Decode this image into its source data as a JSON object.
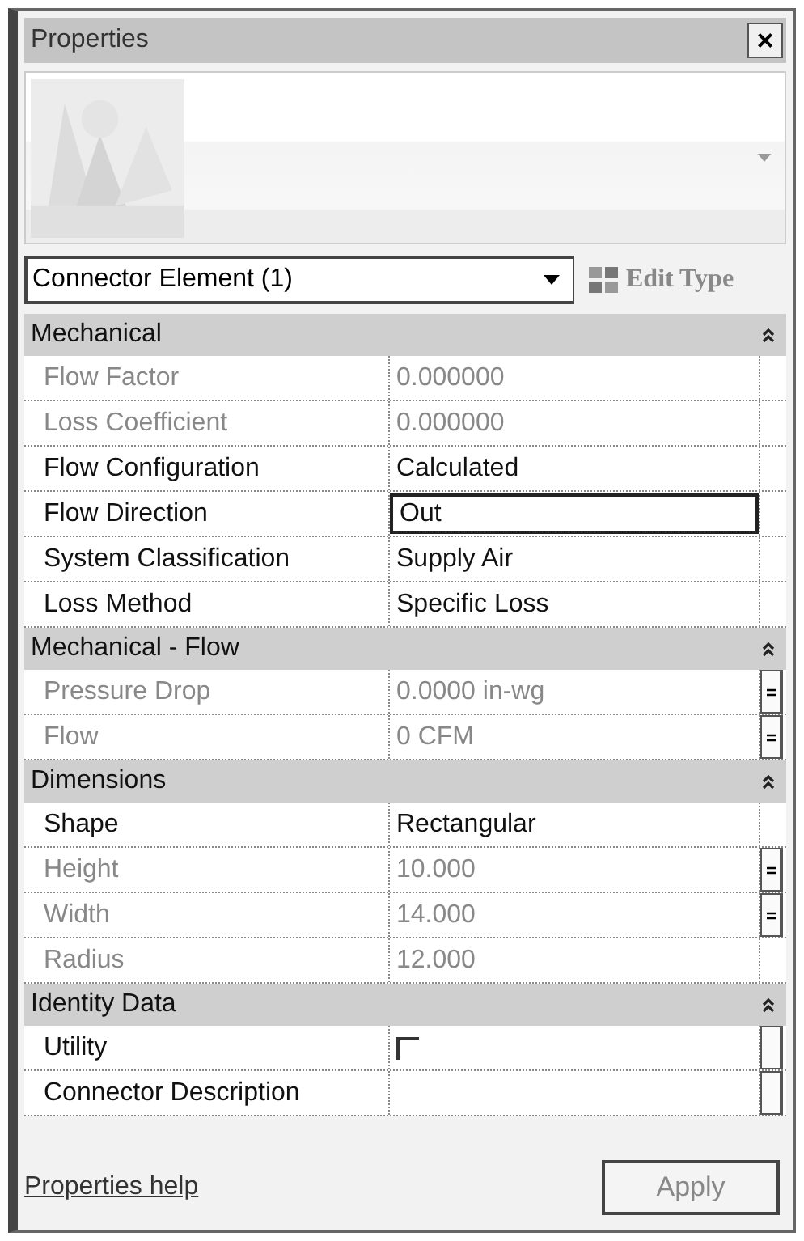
{
  "window": {
    "title": "Properties",
    "close": "×"
  },
  "type_selector": {
    "value": "Connector Element (1)",
    "edit_type": "Edit Type"
  },
  "groups": [
    {
      "title": "Mechanical",
      "expanded": true,
      "rows": [
        {
          "kind": "text",
          "label": "Flow Factor",
          "value": "0.000000",
          "disabled": true,
          "focused": false,
          "has_button": false
        },
        {
          "kind": "text",
          "label": "Loss Coefficient",
          "value": "0.000000",
          "disabled": true,
          "focused": false,
          "has_button": false
        },
        {
          "kind": "text",
          "label": "Flow Configuration",
          "value": "Calculated",
          "disabled": false,
          "focused": false,
          "has_button": false
        },
        {
          "kind": "text",
          "label": "Flow Direction",
          "value": "Out",
          "disabled": false,
          "focused": true,
          "has_button": false
        },
        {
          "kind": "text",
          "label": "System Classification",
          "value": "Supply Air",
          "disabled": false,
          "focused": false,
          "has_button": false
        },
        {
          "kind": "text",
          "label": "Loss Method",
          "value": "Specific Loss",
          "disabled": false,
          "focused": false,
          "has_button": false
        }
      ]
    },
    {
      "title": "Mechanical - Flow",
      "expanded": true,
      "rows": [
        {
          "kind": "text",
          "label": "Pressure Drop",
          "value": "0.0000 in-wg",
          "disabled": true,
          "focused": false,
          "has_button": true,
          "linked": true
        },
        {
          "kind": "text",
          "label": "Flow",
          "value": "0 CFM",
          "disabled": true,
          "focused": false,
          "has_button": true,
          "linked": true
        }
      ]
    },
    {
      "title": "Dimensions",
      "expanded": true,
      "rows": [
        {
          "kind": "text",
          "label": "Shape",
          "value": "Rectangular",
          "disabled": false,
          "focused": false,
          "has_button": false
        },
        {
          "kind": "text",
          "label": "Height",
          "value": "10.000",
          "disabled": true,
          "focused": false,
          "has_button": true,
          "linked": true
        },
        {
          "kind": "text",
          "label": "Width",
          "value": "14.000",
          "disabled": true,
          "focused": false,
          "has_button": true,
          "linked": true
        },
        {
          "kind": "text",
          "label": "Radius",
          "value": "12.000",
          "disabled": true,
          "focused": false,
          "has_button": false
        }
      ]
    },
    {
      "title": "Identity Data",
      "expanded": true,
      "rows": [
        {
          "kind": "checkbox",
          "label": "Utility",
          "checked": false,
          "disabled": false,
          "focused": false,
          "has_button": true,
          "linked": false
        },
        {
          "kind": "text",
          "label": "Connector Description",
          "disabled": false,
          "focused": false,
          "has_button": true,
          "linked": false
        }
      ]
    }
  ],
  "footer": {
    "help_link": "Properties help",
    "apply_button": "Apply",
    "apply_disabled": true
  }
}
